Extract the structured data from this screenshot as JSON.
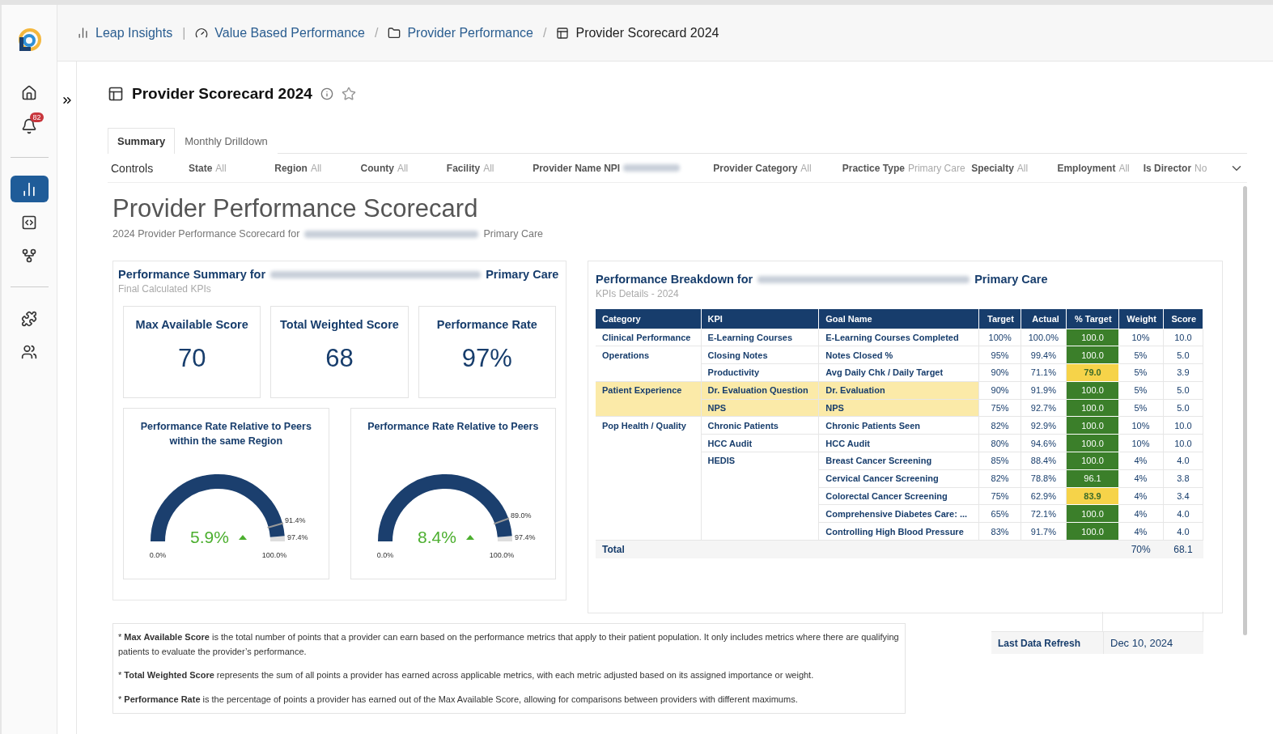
{
  "sidebar": {
    "badge": "82",
    "items": [
      {
        "kind": "home",
        "selected": false
      },
      {
        "kind": "bell",
        "selected": false
      },
      {
        "kind": "chart",
        "selected": true
      },
      {
        "kind": "code",
        "selected": false
      },
      {
        "kind": "flow",
        "selected": false
      },
      {
        "kind": "puzzle",
        "selected": false
      },
      {
        "kind": "people",
        "selected": false
      }
    ]
  },
  "breadcrumbs": [
    {
      "kind": "chart",
      "label": "Leap Insights"
    },
    {
      "separator": "|",
      "kind": "gauge",
      "label": "Value Based Performance"
    },
    {
      "separator": "/",
      "kind": "folder",
      "label": "Provider Performance"
    },
    {
      "separator": "/",
      "kind": "panel",
      "label": "Provider Scorecard 2024"
    }
  ],
  "page_title": "Provider Scorecard 2024",
  "tabs": [
    {
      "label": "Summary",
      "selected": true
    },
    {
      "label": "Monthly Drilldown",
      "selected": false
    }
  ],
  "controls": {
    "label": "Controls",
    "filters": [
      {
        "name": "State",
        "value": "All"
      },
      {
        "name": "Region",
        "value": "All"
      },
      {
        "name": "County",
        "value": "All"
      },
      {
        "name": "Facility",
        "value": "All"
      },
      {
        "name": "Provider Name NPI",
        "redacted": true
      },
      {
        "name": "Provider Category",
        "value": "All"
      },
      {
        "name": "Practice Type",
        "value": "Primary Care"
      },
      {
        "name": "Specialty",
        "value": "All"
      },
      {
        "name": "Employment",
        "value": "All"
      },
      {
        "name": "Is Director",
        "value": "No"
      }
    ]
  },
  "report": {
    "title": "Provider Performance Scorecard",
    "subtitle_before": "2024 Provider Performance Scorecard for",
    "subtitle_after": "Primary Care"
  },
  "summary": {
    "title_before": "Performance Summary for",
    "title_after": "Primary Care",
    "subtitle": "Final Calculated KPIs",
    "kpis": [
      {
        "label": "Max Available Score",
        "value": "70"
      },
      {
        "label": "Total Weighted Score",
        "value": "68"
      },
      {
        "label": "Performance Rate",
        "value": "97%"
      }
    ],
    "gauges": [
      {
        "title": "Performance Rate Relative to Peers within the same Region",
        "delta": "5.9%",
        "min": "0.0%",
        "max": "100.0%",
        "peer": "91.4%",
        "actual": "97.4%"
      },
      {
        "title": "Performance Rate Relative to Peers",
        "delta": "8.4%",
        "min": "0.0%",
        "max": "100.0%",
        "peer": "89.0%",
        "actual": "97.4%"
      }
    ]
  },
  "breakdown": {
    "title_before": "Performance Breakdown for",
    "title_after": "Primary Care",
    "subtitle": "KPIs Details - 2024",
    "columns": [
      "Category",
      "KPI",
      "Goal Name",
      "Target",
      "Actual",
      "% Target",
      "Weight",
      "Score"
    ],
    "rows": [
      {
        "category": "Clinical Performance",
        "kpi": "E-Learning Courses",
        "goal": "E-Learning Courses Completed",
        "target": "100%",
        "actual": "100.0%",
        "pct": "100.0",
        "color": "#3b7f2a",
        "weight": "10%",
        "score": "10.0",
        "highlighted": false
      },
      {
        "category": "Operations",
        "kpi": "Closing Notes",
        "goal": "Notes Closed %",
        "target": "95%",
        "actual": "99.4%",
        "pct": "100.0",
        "color": "#3b7f2a",
        "weight": "5%",
        "score": "5.0",
        "highlighted": false
      },
      {
        "kpi": "Productivity",
        "goal": "Avg Daily Chk / Daily Target",
        "target": "90%",
        "actual": "71.1%",
        "pct": "79.0",
        "color": "#f6d349",
        "weight": "5%",
        "score": "3.9",
        "highlighted": false
      },
      {
        "category": "Patient Experience",
        "kpi": "Dr. Evaluation Question",
        "goal": "Dr. Evaluation",
        "target": "90%",
        "actual": "91.9%",
        "pct": "100.0",
        "color": "#3b7f2a",
        "weight": "5%",
        "score": "5.0",
        "highlighted": true
      },
      {
        "kpi": "NPS",
        "goal": "NPS",
        "target": "75%",
        "actual": "92.7%",
        "pct": "100.0",
        "color": "#3b7f2a",
        "weight": "5%",
        "score": "5.0",
        "highlighted": true
      },
      {
        "category": "Pop Health / Quality",
        "kpi": "Chronic Patients",
        "goal": "Chronic Patients Seen",
        "target": "82%",
        "actual": "92.9%",
        "pct": "100.0",
        "color": "#3b7f2a",
        "weight": "10%",
        "score": "10.0",
        "highlighted": false
      },
      {
        "kpi": "HCC Audit",
        "goal": "HCC Audit",
        "target": "80%",
        "actual": "94.6%",
        "pct": "100.0",
        "color": "#3b7f2a",
        "weight": "10%",
        "score": "10.0",
        "highlighted": false
      },
      {
        "kpi": "HEDIS",
        "goal": "Breast Cancer Screening",
        "target": "85%",
        "actual": "88.4%",
        "pct": "100.0",
        "color": "#3b7f2a",
        "weight": "4%",
        "score": "4.0",
        "highlighted": false
      },
      {
        "goal": "Cervical Cancer Screening",
        "target": "82%",
        "actual": "78.8%",
        "pct": "96.1",
        "color": "#3b7f2a",
        "weight": "4%",
        "score": "3.8",
        "highlighted": false
      },
      {
        "goal": "Colorectal Cancer Screening",
        "target": "75%",
        "actual": "62.9%",
        "pct": "83.9",
        "color": "#f6d349",
        "weight": "4%",
        "score": "3.4",
        "highlighted": false
      },
      {
        "goal": "Comprehensive Diabetes Care: ...",
        "target": "65%",
        "actual": "72.1%",
        "pct": "100.0",
        "color": "#3b7f2a",
        "weight": "4%",
        "score": "4.0",
        "highlighted": false
      },
      {
        "goal": "Controlling High Blood Pressure",
        "target": "83%",
        "actual": "91.7%",
        "pct": "100.0",
        "color": "#3b7f2a",
        "weight": "4%",
        "score": "4.0",
        "highlighted": false
      }
    ],
    "total": {
      "label": "Total",
      "weight": "70%",
      "score": "68.1"
    }
  },
  "notes": [
    "* **Max Available Score** is the total number of points that a provider can earn based on the performance metrics that apply to their patient population. It only includes metrics where there are qualifying patients to evaluate the provider’s performance.",
    "* **Total Weighted Score** represents the sum of all points a provider has earned across applicable metrics, with each metric adjusted based on its assigned importance or weight.",
    "* **Performance Rate** is the percentage of points a provider has earned out of the Max Available Score, allowing for comparisons between providers with different maximums."
  ],
  "refresh": {
    "label": "Last Data Refresh",
    "value": "Dec 10, 2024"
  }
}
